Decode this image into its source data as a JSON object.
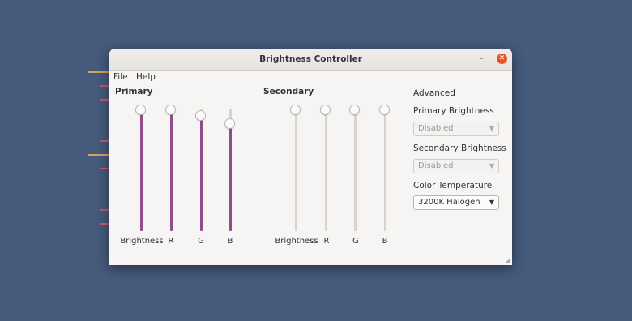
{
  "window": {
    "title": "Brightness Controller"
  },
  "menu": [
    "File",
    "Help"
  ],
  "primary": {
    "label": "Primary",
    "sliders": [
      {
        "label": "Brightness",
        "value": 1.0
      },
      {
        "label": "R",
        "value": 1.0
      },
      {
        "label": "G",
        "value": 0.95
      },
      {
        "label": "B",
        "value": 0.88
      }
    ]
  },
  "secondary": {
    "label": "Secondary",
    "sliders": [
      {
        "label": "Brightness",
        "value": 1.0
      },
      {
        "label": "R",
        "value": 1.0
      },
      {
        "label": "G",
        "value": 1.0
      },
      {
        "label": "B",
        "value": 1.0
      }
    ]
  },
  "advanced": {
    "label": "Advanced",
    "primary_brightness": {
      "label": "Primary Brightness",
      "value": "Disabled"
    },
    "secondary_brightness": {
      "label": "Secondary Brightness",
      "value": "Disabled"
    },
    "color_temperature": {
      "label": "Color Temperature",
      "value": "3200K Halogen"
    }
  },
  "colors": {
    "accent": "#924d8b",
    "close": "#e95420",
    "desktop": "#465a7b"
  }
}
